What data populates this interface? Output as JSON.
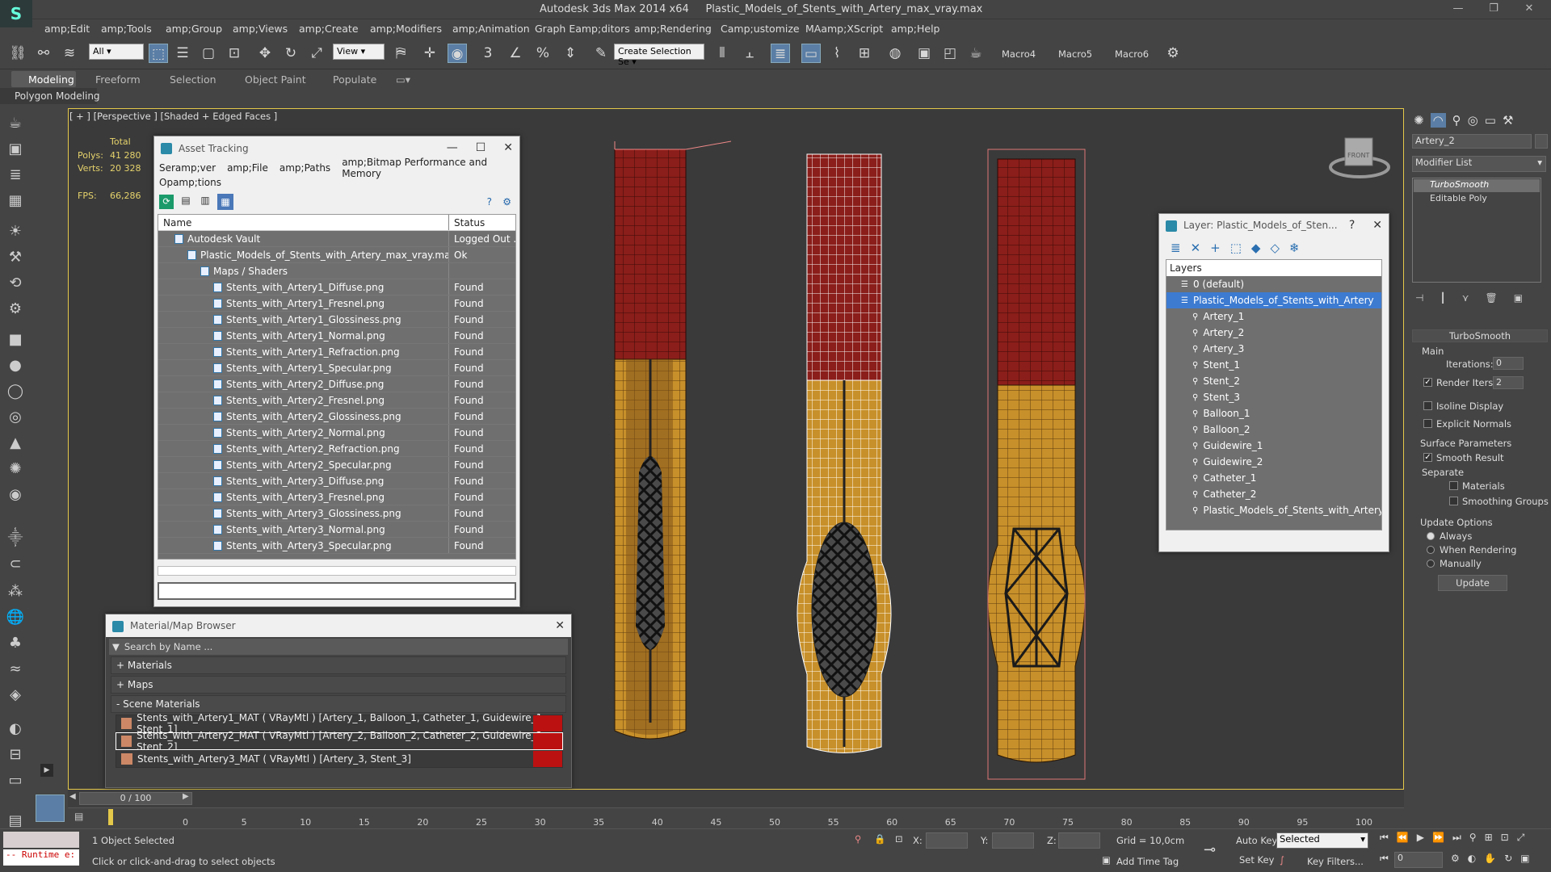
{
  "titlebar": {
    "app": "Autodesk 3ds Max  2014 x64",
    "file": "Plastic_Models_of_Stents_with_Artery_max_vray.max"
  },
  "menu": [
    "amp;Edit",
    "amp;Tools",
    "amp;Group",
    "amp;Views",
    "amp;Create",
    "amp;Modifiers",
    "amp;Animation",
    "Graph Eamp;ditors",
    "amp;Rendering",
    "Camp;ustomize",
    "MAamp;XScript",
    "amp;Help"
  ],
  "toolbar": {
    "filter": "All",
    "view": "View",
    "selection_set": "Create Selection Se",
    "macros": [
      "Macro4",
      "Macro5",
      "Macro6"
    ]
  },
  "ribbon": {
    "tabs": [
      "Modeling",
      "Freeform",
      "Selection",
      "Object Paint",
      "Populate"
    ],
    "sub": "Polygon Modeling"
  },
  "viewport": {
    "label": "[ + ] [Perspective ] [Shaded + Edged Faces ]",
    "stats": {
      "total": "Total",
      "polys_label": "Polys:",
      "polys": "41 280",
      "verts_label": "Verts:",
      "verts": "20 328",
      "fps_label": "FPS:",
      "fps": "66,286"
    },
    "viewcube": "FRONT"
  },
  "asset_tracking": {
    "title": "Asset Tracking",
    "menu": [
      "Seramp;ver",
      "amp;File",
      "amp;Paths",
      "amp;Bitmap Performance and Memory"
    ],
    "menu2": "Opamp;tions",
    "columns": [
      "Name",
      "Status"
    ],
    "rows": [
      {
        "name": "Autodesk Vault",
        "status": "Logged Out ..."
      },
      {
        "name": "Plastic_Models_of_Stents_with_Artery_max_vray.max",
        "status": "Ok"
      },
      {
        "name": "Maps / Shaders",
        "status": ""
      },
      {
        "name": "Stents_with_Artery1_Diffuse.png",
        "status": "Found"
      },
      {
        "name": "Stents_with_Artery1_Fresnel.png",
        "status": "Found"
      },
      {
        "name": "Stents_with_Artery1_Glossiness.png",
        "status": "Found"
      },
      {
        "name": "Stents_with_Artery1_Normal.png",
        "status": "Found"
      },
      {
        "name": "Stents_with_Artery1_Refraction.png",
        "status": "Found"
      },
      {
        "name": "Stents_with_Artery1_Specular.png",
        "status": "Found"
      },
      {
        "name": "Stents_with_Artery2_Diffuse.png",
        "status": "Found"
      },
      {
        "name": "Stents_with_Artery2_Fresnel.png",
        "status": "Found"
      },
      {
        "name": "Stents_with_Artery2_Glossiness.png",
        "status": "Found"
      },
      {
        "name": "Stents_with_Artery2_Normal.png",
        "status": "Found"
      },
      {
        "name": "Stents_with_Artery2_Refraction.png",
        "status": "Found"
      },
      {
        "name": "Stents_with_Artery2_Specular.png",
        "status": "Found"
      },
      {
        "name": "Stents_with_Artery3_Diffuse.png",
        "status": "Found"
      },
      {
        "name": "Stents_with_Artery3_Fresnel.png",
        "status": "Found"
      },
      {
        "name": "Stents_with_Artery3_Glossiness.png",
        "status": "Found"
      },
      {
        "name": "Stents_with_Artery3_Normal.png",
        "status": "Found"
      },
      {
        "name": "Stents_with_Artery3_Specular.png",
        "status": "Found"
      }
    ]
  },
  "material_browser": {
    "title": "Material/Map Browser",
    "search_placeholder": "Search by Name ...",
    "groups": [
      "+ Materials",
      "+ Maps",
      "- Scene Materials"
    ],
    "materials": [
      "Stents_with_Artery1_MAT  ( VRayMtl )  [Artery_1, Balloon_1, Catheter_1, Guidewire_1, Stent_1]",
      "Stents_with_Artery2_MAT  ( VRayMtl )  [Artery_2, Balloon_2, Catheter_2, Guidewire_2, Stent_2]",
      "Stents_with_Artery3_MAT  ( VRayMtl )  [Artery_3, Stent_3]"
    ]
  },
  "layer_window": {
    "title": "Layer: Plastic_Models_of_Sten...",
    "header": "Layers",
    "items": [
      "0 (default)",
      "Plastic_Models_of_Stents_with_Artery",
      "Artery_1",
      "Artery_2",
      "Artery_3",
      "Stent_1",
      "Stent_2",
      "Stent_3",
      "Balloon_1",
      "Balloon_2",
      "Guidewire_1",
      "Guidewire_2",
      "Catheter_1",
      "Catheter_2",
      "Plastic_Models_of_Stents_with_Artery"
    ]
  },
  "command_panel": {
    "object_name": "Artery_2",
    "modifier_list": "Modifier List",
    "stack": [
      "TurboSmooth",
      "Editable Poly"
    ],
    "rollout": "TurboSmooth",
    "main": "Main",
    "iterations_label": "Iterations:",
    "iterations": "0",
    "render_iters_label": "Render Iters:",
    "render_iters": "2",
    "isoline": "Isoline Display",
    "explicit": "Explicit Normals",
    "surface": "Surface Parameters",
    "smooth": "Smooth Result",
    "separate": "Separate",
    "materials": "Materials",
    "smoothing_groups": "Smoothing Groups",
    "update_options": "Update Options",
    "always": "Always",
    "when_rendering": "When Rendering",
    "manually": "Manually",
    "update": "Update"
  },
  "timeline": {
    "frame": "0 / 100",
    "ticks": [
      "0",
      "5",
      "10",
      "15",
      "20",
      "25",
      "30",
      "35",
      "40",
      "45",
      "50",
      "55",
      "60",
      "65",
      "70",
      "75",
      "80",
      "85",
      "90",
      "95",
      "100"
    ]
  },
  "status": {
    "runtime": "-- Runtime e:",
    "selected": "1 Object Selected",
    "prompt": "Click or click-and-drag to select objects",
    "x": "X:",
    "y": "Y:",
    "z": "Z:",
    "grid": "Grid = 10,0cm",
    "auto_key": "Auto Key",
    "set_key": "Set Key",
    "selected_dd": "Selected",
    "key_filters": "Key Filters...",
    "add_time_tag": "Add Time Tag",
    "frame_box": "0"
  },
  "colors": {
    "viewport_border": "#e3c84a",
    "stats": "#e6d36c",
    "artery_red": "#8b1e1a",
    "artery_gold": "#c8902a"
  }
}
